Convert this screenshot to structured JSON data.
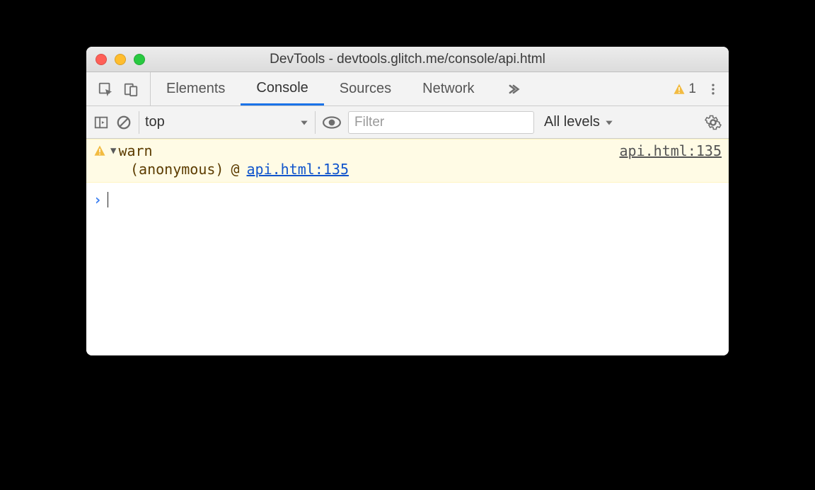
{
  "window": {
    "title": "DevTools - devtools.glitch.me/console/api.html"
  },
  "tabs": {
    "elements": "Elements",
    "console": "Console",
    "sources": "Sources",
    "network": "Network"
  },
  "warnings": {
    "count": "1"
  },
  "toolbar": {
    "context": "top",
    "filter_placeholder": "Filter",
    "levels": "All levels"
  },
  "message": {
    "label": "warn",
    "source": "api.html:135",
    "stack_fn": "(anonymous)",
    "stack_at": "@",
    "stack_link": "api.html:135"
  }
}
